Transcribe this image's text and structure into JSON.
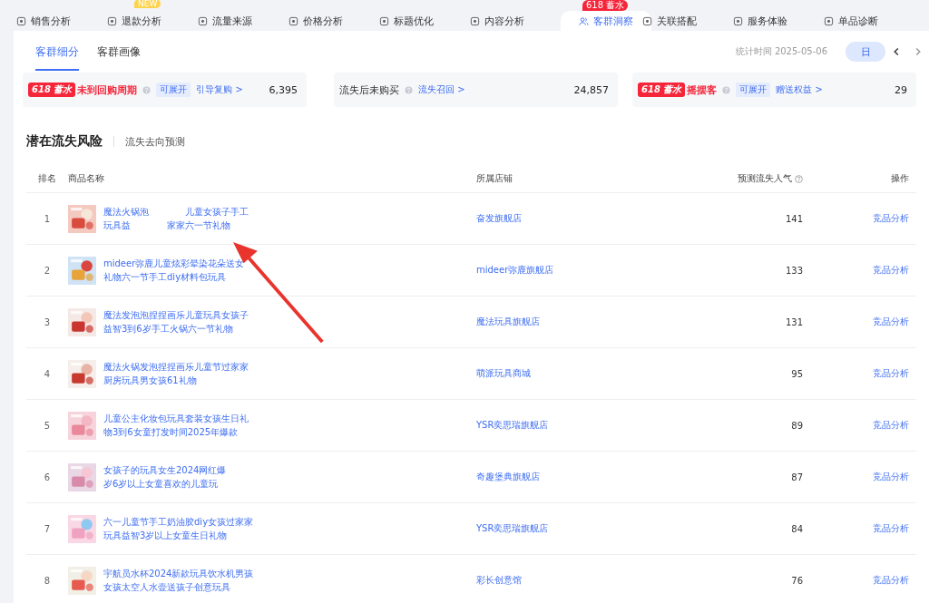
{
  "tabs": [
    {
      "label": "销售分析",
      "selected": false
    },
    {
      "label": "退款分析",
      "selected": false,
      "badge": "NEW"
    },
    {
      "label": "流量来源",
      "selected": false
    },
    {
      "label": "价格分析",
      "selected": false
    },
    {
      "label": "标题优化",
      "selected": false
    },
    {
      "label": "内容分析",
      "selected": false
    },
    {
      "label": "客群洞察",
      "selected": true,
      "badge": "618 蓄水"
    },
    {
      "label": "关联搭配",
      "selected": false
    },
    {
      "label": "服务体验",
      "selected": false
    },
    {
      "label": "单品诊断",
      "selected": false
    }
  ],
  "subtabs": [
    {
      "label": "客群细分",
      "selected": true
    },
    {
      "label": "客群画像",
      "selected": false
    }
  ],
  "stat_time": "统计时间 2025-05-06",
  "period_button": "日",
  "cards": [
    {
      "tag": "618 蓄水",
      "title": "未到回购周期",
      "highlight": true,
      "expandable": "可展开",
      "link": "引导复购 >",
      "value": "6,395"
    },
    {
      "title": "流失后未购买",
      "highlight": false,
      "link": "流失召回 >",
      "value": "24,857"
    },
    {
      "tag": "618 蓄水",
      "title": "摇摆客",
      "highlight": true,
      "expandable": "可展开",
      "link": "赠送权益 >",
      "value": "29"
    }
  ],
  "section": {
    "title": "潜在流失风险",
    "tab": "流失去向预测"
  },
  "table": {
    "columns": [
      "排名",
      "商品名称",
      "所属店铺",
      "预测流失人气",
      "操作"
    ],
    "rows": [
      {
        "rank": "1",
        "name": [
          "魔法火锅泡　　　　儿童女孩子手工",
          "玩具益　　　　家家六一节礼物"
        ],
        "store": "奋发旗舰店",
        "value": "141",
        "action": "竞品分析"
      },
      {
        "rank": "2",
        "name": [
          "mideer弥鹿儿童炫彩晕染花朵送女",
          "礼物六一节手工diy材料包玩具"
        ],
        "store": "mideer弥鹿旗舰店",
        "value": "133",
        "action": "竞品分析"
      },
      {
        "rank": "3",
        "name": [
          "魔法发泡泡捏捏画乐儿童玩具女孩子",
          "益智3到6岁手工火锅六一节礼物"
        ],
        "store": "魔法玩具旗舰店",
        "value": "131",
        "action": "竞品分析"
      },
      {
        "rank": "4",
        "name": [
          "魔法火锅发泡捏捏画乐儿童节过家家",
          "厨房玩具男女孩61礼物"
        ],
        "store": "萌派玩具商城",
        "value": "95",
        "action": "竞品分析"
      },
      {
        "rank": "5",
        "name": [
          "儿童公主化妆包玩具套装女孩生日礼",
          "物3到6女童打发时间2025年爆款"
        ],
        "store": "YSR奕思瑞旗舰店",
        "value": "89",
        "action": "竞品分析"
      },
      {
        "rank": "6",
        "name": [
          "女孩子的玩具女生2024网红爆",
          "岁6岁以上女童喜欢的儿童玩"
        ],
        "store": "奇趣堡典旗舰店",
        "value": "87",
        "action": "竞品分析"
      },
      {
        "rank": "7",
        "name": [
          "六一儿童节手工奶油胶diy女孩过家家",
          "玩具益智3岁以上女童生日礼物"
        ],
        "store": "YSR奕思瑞旗舰店",
        "value": "84",
        "action": "竞品分析"
      },
      {
        "rank": "8",
        "name": [
          "宇航员水杯2024新款玩具饮水机男孩",
          "女孩太空人水壶送孩子创意玩具"
        ],
        "store": "彩长创意馆",
        "value": "76",
        "action": "竞品分析"
      }
    ]
  }
}
